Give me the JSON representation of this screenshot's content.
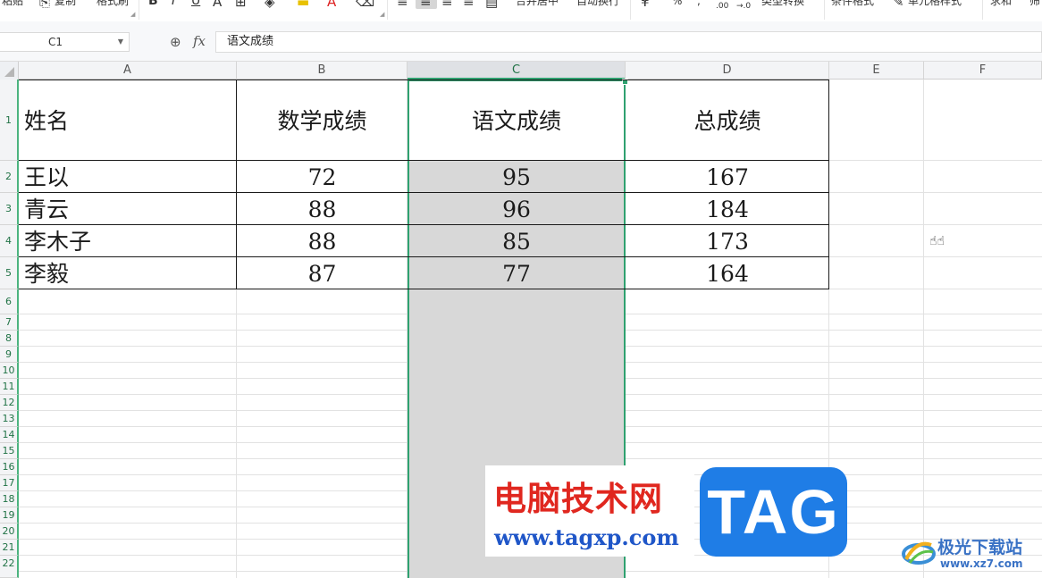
{
  "toolbar": {
    "paste": "粘贴",
    "copy": "复制",
    "format_painter": "格式刷",
    "bold": "B",
    "italic": "I",
    "underline": "U",
    "merge_center": "合并居中",
    "wrap_text": "自动换行",
    "percent": "%",
    "thousands": ",",
    "dec_increase": ".00",
    "dec_decrease": "→.0",
    "type_convert": "类型转换",
    "conditional_format": "条件格式",
    "cell_style": "单元格样式",
    "sum": "求和",
    "filter": "筛"
  },
  "formula_bar": {
    "cell_ref": "C1",
    "fx_label": "fx",
    "content": "语文成绩"
  },
  "columns": [
    "A",
    "B",
    "C",
    "D",
    "E",
    "F"
  ],
  "selected_column": "C",
  "rows": [
    "1",
    "2",
    "3",
    "4",
    "5",
    "6",
    "7",
    "8",
    "9",
    "10",
    "11",
    "12",
    "13",
    "14",
    "15",
    "16",
    "17",
    "18",
    "19",
    "20",
    "21",
    "22"
  ],
  "table": {
    "headers": [
      "姓名",
      "数学成绩",
      "语文成绩",
      "总成绩"
    ],
    "rows": [
      [
        "王以",
        "72",
        "95",
        "167"
      ],
      [
        "青云",
        "88",
        "96",
        "184"
      ],
      [
        "李木子",
        "88",
        "85",
        "173"
      ],
      [
        "李毅",
        "87",
        "77",
        "164"
      ]
    ]
  },
  "watermarks": {
    "site_title": "电脑技术网",
    "site_url": "www.tagxp.com",
    "tag": "TAG",
    "brand2_title": "极光下载站",
    "brand2_url": "www.xz7.com"
  },
  "colors": {
    "accent": "#2fa170",
    "selection_fill": "#d8d8d8",
    "watermark_red": "#e0271f",
    "watermark_blue": "#1f56c8",
    "tag_blue": "#1f7de6"
  }
}
